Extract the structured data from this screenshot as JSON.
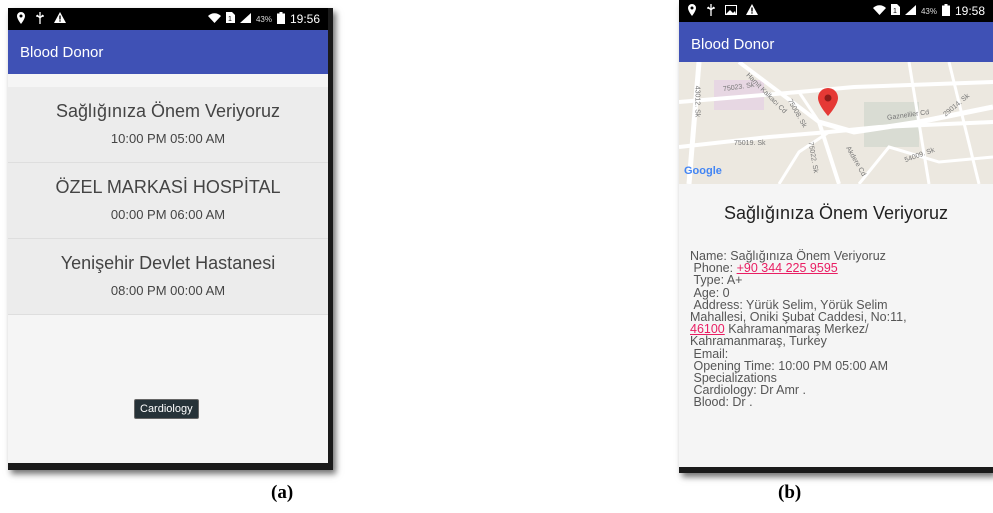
{
  "screen_a": {
    "status": {
      "signal_pct": "43%",
      "time": "19:56"
    },
    "app_title": "Blood Donor",
    "items": [
      {
        "name": "Sağlığınıza Önem Veriyoruz",
        "hours": "10:00 PM 05:00 AM"
      },
      {
        "name": "ÖZEL MARKASİ HOSPİTAL",
        "hours": "00:00 PM 06:00 AM"
      },
      {
        "name": "Yenişehir Devlet Hastanesi",
        "hours": "08:00 PM 00:00 AM"
      }
    ],
    "toast": "Cardiology"
  },
  "screen_b": {
    "status": {
      "signal_pct": "43%",
      "time": "19:58"
    },
    "app_title": "Blood Donor",
    "map": {
      "attribution": "Google",
      "labels": [
        "75023. Sk",
        "Hamit Kalkacı Cd",
        "75008. Sk",
        "Gazneliler Cd",
        "75019. Sk",
        "75022. Sk",
        "Akdere Cd",
        "54009. Sk",
        "43012. Sk",
        "29014. Sk"
      ]
    },
    "title": "Sağlığınıza Önem Veriyoruz",
    "details": {
      "name": "Name: Sağlığınıza Önem Veriyoruz",
      "phone_label": " Phone: ",
      "phone": "+90 344 225 9595",
      "type": " Type: A+",
      "age": " Age: 0",
      "address_1": " Address: Yürük Selim, Yörük Selim",
      "address_2": "Mahallesi, Oniki Şubat Caddesi, No:11,",
      "postal": "46100",
      "address_3": " Kahramanmaraş Merkez/",
      "address_4": "Kahramanmaraş, Turkey",
      "email": " Email:",
      "opening": " Opening Time: 10:00 PM 05:00 AM",
      "specializations": " Specializations",
      "cardiology": " Cardiology: Dr Amr .",
      "blood": " Blood: Dr ."
    }
  },
  "captions": {
    "a": "(a)",
    "b": "(b)"
  },
  "colors": {
    "appbar": "#3f51b5",
    "link": "#e91e63",
    "map_pin": "#e53935"
  }
}
